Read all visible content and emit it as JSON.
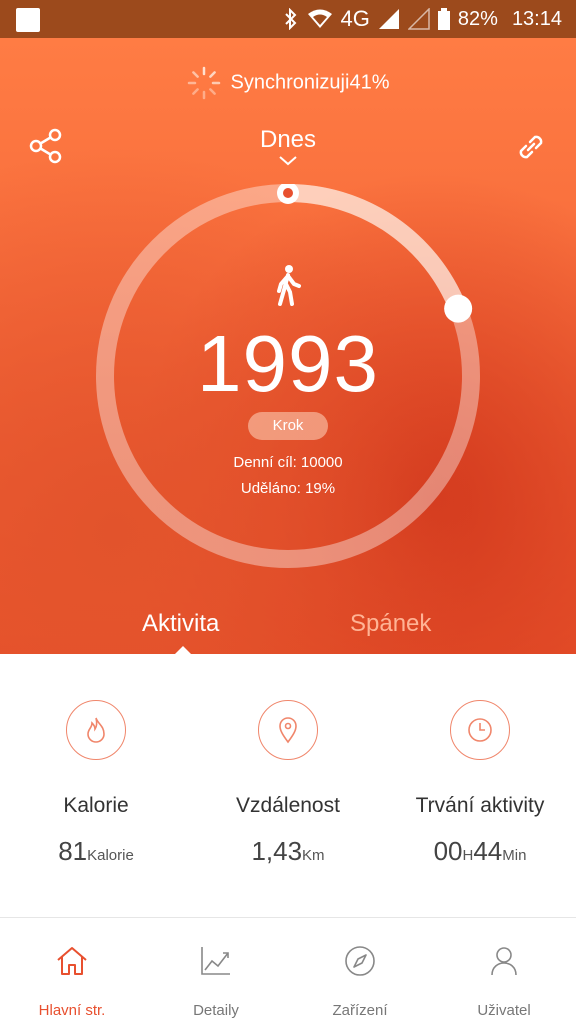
{
  "status_bar": {
    "network": "4G",
    "battery": "82%",
    "time": "13:14"
  },
  "header": {
    "sync_text": "Synchronizuji41%",
    "date_label": "Dnes",
    "share_icon": "share-icon",
    "link_icon": "link-icon"
  },
  "ring": {
    "steps": "1993",
    "unit_badge": "Krok",
    "daily_goal": "Denní cíl: 10000",
    "done": "Uděláno: 19%",
    "progress": 0.19
  },
  "tabs": {
    "activity": "Aktivita",
    "sleep": "Spánek"
  },
  "stats": {
    "calories": {
      "label": "Kalorie",
      "value": "81",
      "unit": "Kalorie",
      "icon": "flame-icon"
    },
    "distance": {
      "label": "Vzdálenost",
      "value": "1,43",
      "unit": "Km",
      "icon": "location-pin-icon"
    },
    "duration": {
      "label": "Trvání aktivity",
      "hours": "00",
      "h_unit": "H",
      "minutes": "44",
      "m_unit": "Min",
      "icon": "clock-icon"
    }
  },
  "nav": {
    "home": "Hlavní str.",
    "details": "Detaily",
    "device": "Zařízení",
    "user": "Uživatel"
  },
  "colors": {
    "accent": "#e8502f",
    "hero_top": "#ff7c44",
    "hero_bottom": "#d33a1e"
  }
}
